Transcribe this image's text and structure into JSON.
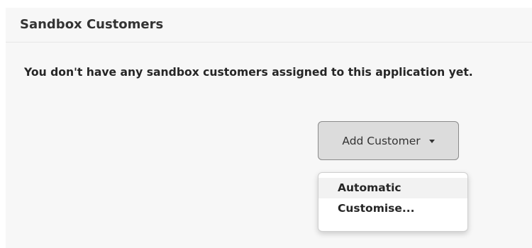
{
  "panel": {
    "title": "Sandbox Customers",
    "empty_message": "You don't have any sandbox customers assigned to this application yet."
  },
  "add_customer": {
    "label": "Add Customer",
    "icon": "caret-down-icon",
    "menu": {
      "expanded": true,
      "items": [
        {
          "label": "Automatic",
          "highlighted": true
        },
        {
          "label": "Customise..."
        }
      ]
    }
  },
  "colors": {
    "panel_background": "#f7f7f7",
    "button_background": "#dcdcdc",
    "button_border": "#8a8a8a",
    "menu_highlight": "#f2f2f2",
    "text": "#262626"
  }
}
